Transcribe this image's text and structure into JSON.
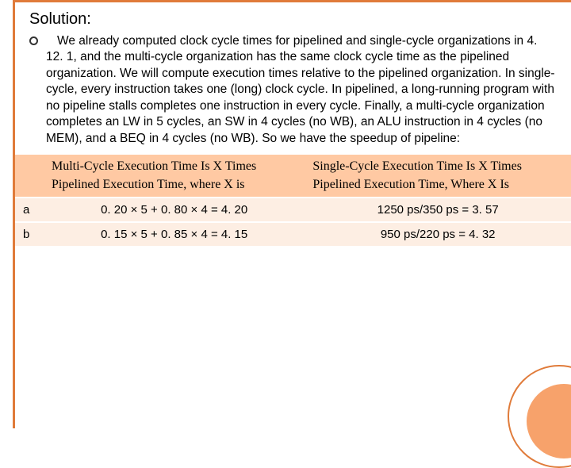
{
  "title": "Solution:",
  "paragraph": "We already computed clock cycle times for pipelined and single-cycle organizations in 4. 12. 1, and the multi-cycle organization has the same clock cycle time as the pipelined organization. We will compute execution times relative to the pipelined organization. In single-cycle, every instruction takes one (long) clock cycle. In pipelined, a long-running program with no pipeline stalls completes one instruction in every cycle. Finally, a multi-cycle organization completes an LW in 5 cycles, an SW in 4 cycles (no WB), an ALU instruction in 4 cycles (no MEM), and a BEQ in 4 cycles (no WB). So we have the speedup of pipeline:",
  "table": {
    "headers": {
      "c0": "",
      "c1_line1": "Multi-Cycle Execution Time Is X Times",
      "c1_line2": "Pipelined Execution Time, where X is",
      "c2_line1": "Single-Cycle Execution Time Is X Times",
      "c2_line2": "Pipelined Execution Time, Where X Is"
    },
    "rows": [
      {
        "label": "a",
        "multi": "0. 20 × 5 + 0. 80 × 4 = 4. 20",
        "single": "1250 ps/350 ps = 3. 57"
      },
      {
        "label": "b",
        "multi": "0. 15 × 5 + 0. 85 × 4 = 4. 15",
        "single": "950 ps/220 ps = 4. 32"
      }
    ]
  }
}
